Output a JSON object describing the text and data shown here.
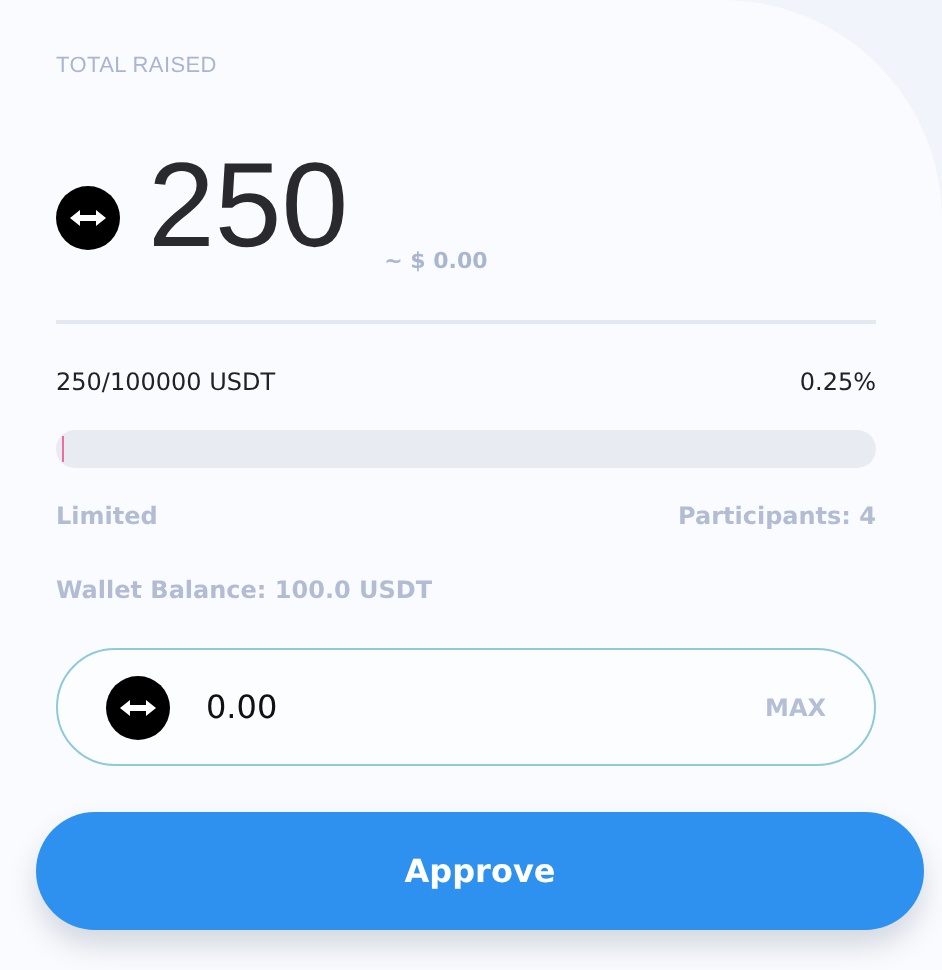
{
  "total_raised": {
    "label": "TOTAL RAISED",
    "amount": "250",
    "usd": "~ $ 0.00"
  },
  "progress": {
    "raised": "250/100000 USDT",
    "percent": "0.25%",
    "level": 0.0025
  },
  "limited": "Limited",
  "participants": "Participants: 4",
  "wallet_balance": "Wallet Balance: 100.0 USDT",
  "amount_input": {
    "value": "0.00",
    "max": "MAX"
  },
  "button": "Approve"
}
